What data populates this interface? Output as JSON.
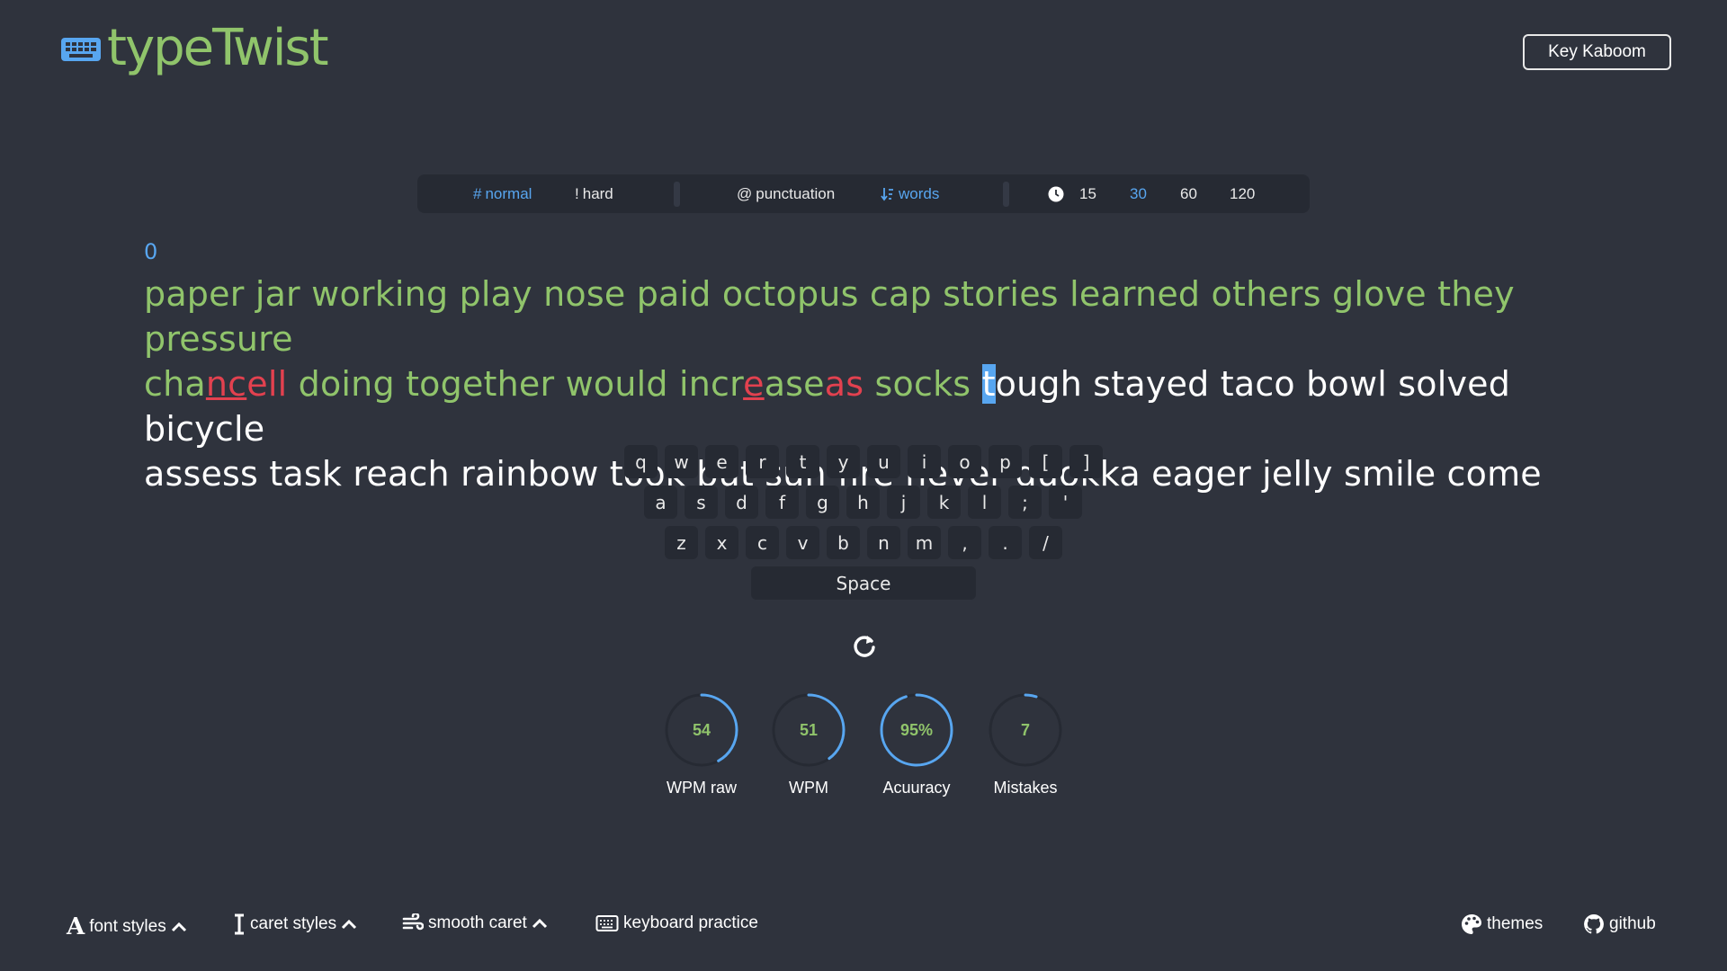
{
  "header": {
    "logo_text": "typeTwist",
    "logo_icon": "keyboard-icon",
    "kaboom_button": "Key Kaboom"
  },
  "toolbar": {
    "normal": "normal",
    "hard": "hard",
    "punctuation": "punctuation",
    "words": "words",
    "times": [
      "15",
      "30",
      "60",
      "120"
    ],
    "active_time": "30"
  },
  "test": {
    "counter": "0",
    "words_line1": [
      "paper",
      "jar",
      "working",
      "play",
      "nose",
      "paid",
      "octopus",
      "cap",
      "stories",
      "learned",
      "others",
      "glove",
      "they",
      "pressure"
    ],
    "line2_correct_prefix": "cha",
    "line2_error_underlined": "nc",
    "line2_error_extra": "ell",
    "line2_words": [
      "doing",
      "together",
      "would"
    ],
    "increase_prefix": "incr",
    "increase_error": "e",
    "increase_suffix": "ase",
    "increase_extra": "as",
    "socks": "socks",
    "caret_letter": "t",
    "current_rest": "ough",
    "upcoming_line2": [
      "stayed",
      "taco",
      "bowl",
      "solved",
      "bicycle"
    ],
    "upcoming_line3": "assess task reach rainbow took but sun fire never quokka eager jelly smile come"
  },
  "keyboard": {
    "row1": [
      "q",
      "w",
      "e",
      "r",
      "t",
      "y",
      "u",
      "i",
      "o",
      "p",
      "[",
      "]"
    ],
    "row2": [
      "a",
      "s",
      "d",
      "f",
      "g",
      "h",
      "j",
      "k",
      "l",
      ";",
      "'"
    ],
    "row3": [
      "z",
      "x",
      "c",
      "v",
      "b",
      "n",
      "m",
      ",",
      ".",
      "/"
    ],
    "space": "Space"
  },
  "stats": [
    {
      "value": "54",
      "label": "WPM raw",
      "fraction": 0.42
    },
    {
      "value": "51",
      "label": "WPM",
      "fraction": 0.4
    },
    {
      "value": "95%",
      "label": "Acuuracy",
      "fraction": 0.95
    },
    {
      "value": "7",
      "label": "Mistakes",
      "fraction": 0.05
    }
  ],
  "footer": {
    "font_styles": "font styles",
    "caret_styles": "caret styles",
    "smooth_caret": "smooth caret",
    "keyboard_practice": "keyboard practice",
    "themes": "themes",
    "github": "github"
  },
  "colors": {
    "background": "#2f333d",
    "correct": "#90c46b",
    "error": "#e2414f",
    "accent": "#58a6f0"
  }
}
